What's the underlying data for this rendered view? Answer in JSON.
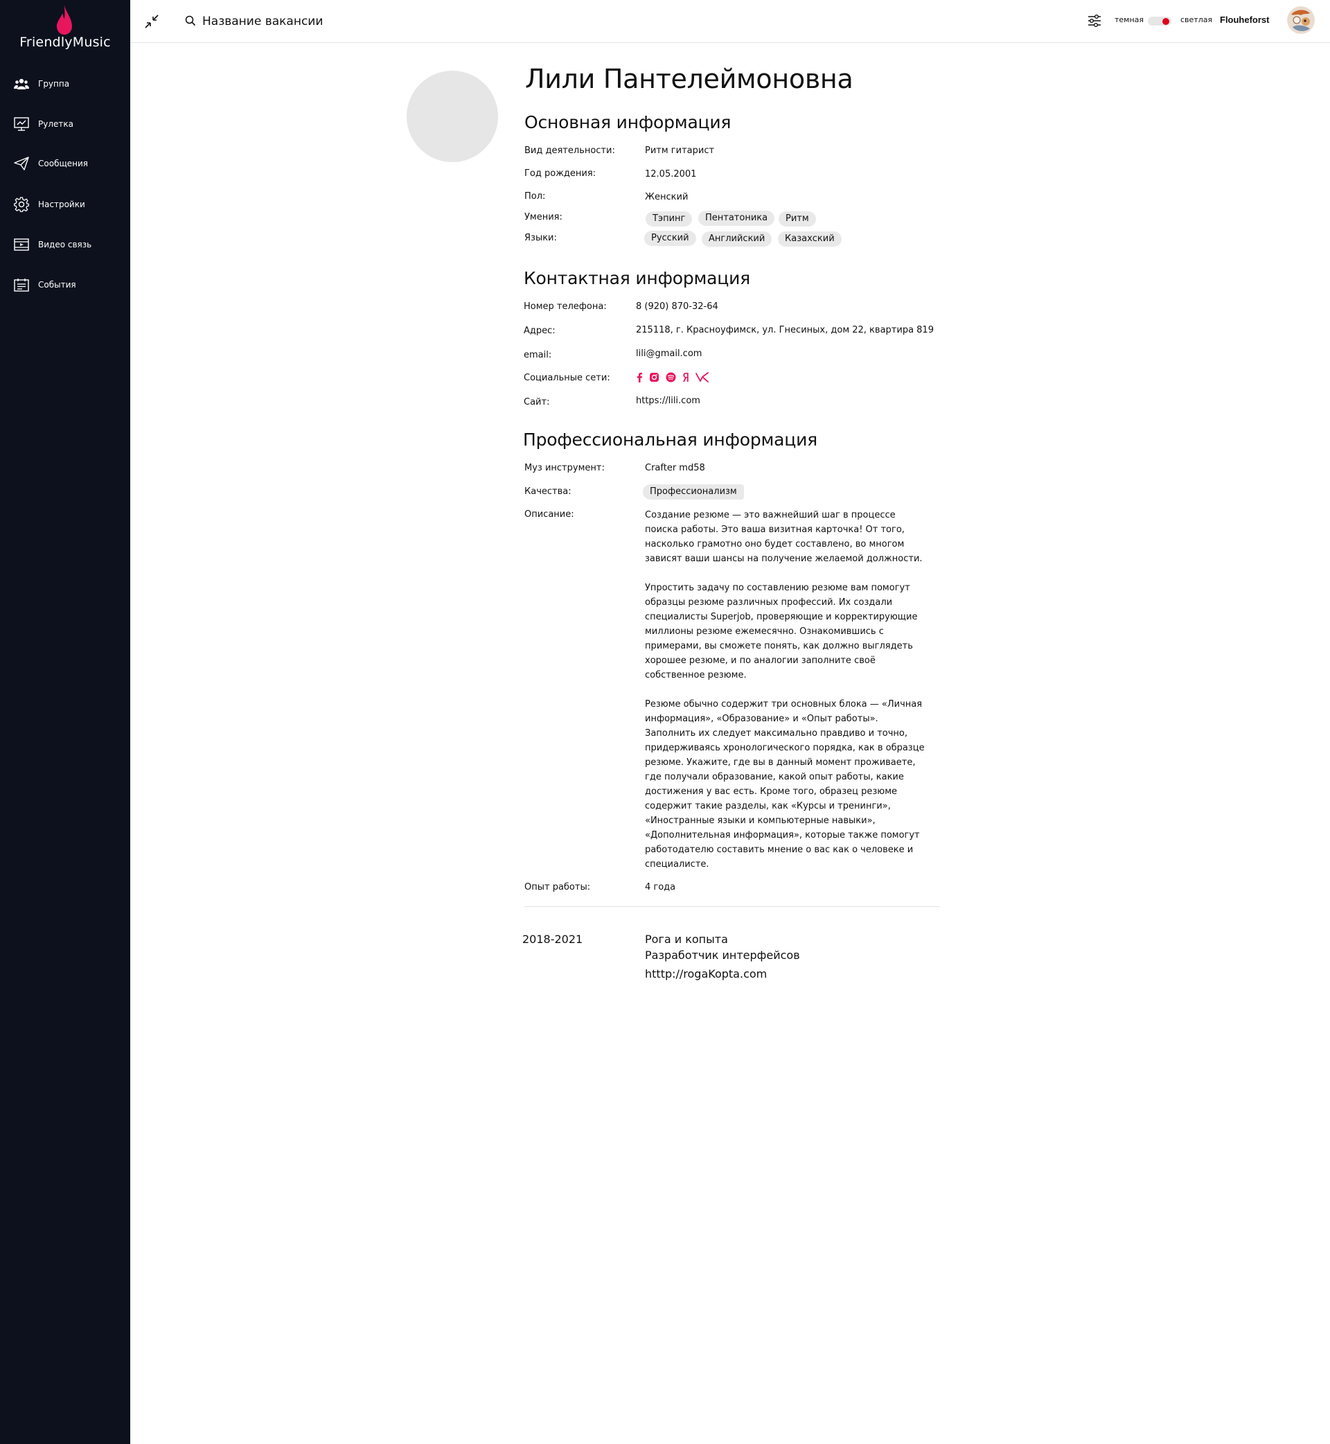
{
  "app": {
    "brand": "FriendlyMusic",
    "accent": "#e8175d"
  },
  "sidebar": {
    "items": [
      {
        "label": "Группа",
        "icon": "group-icon"
      },
      {
        "label": "Рулетка",
        "icon": "roulette-icon"
      },
      {
        "label": "Сообщения",
        "icon": "send-icon"
      },
      {
        "label": "Настройки",
        "icon": "gear-icon"
      },
      {
        "label": "Видео связь",
        "icon": "video-icon"
      },
      {
        "label": "События",
        "icon": "events-icon"
      }
    ]
  },
  "header": {
    "search_placeholder": "Название вакансии",
    "theme_dark": "темная",
    "theme_light": "светлая",
    "theme_toggle": "light",
    "username": "Flouheforst"
  },
  "profile": {
    "name": "Лили Пантелеймоновна",
    "basic": {
      "title": "Основная информация",
      "activity_label": "Вид деятельности:",
      "activity": "Ритм гитарист",
      "birth_label": "Год рождения:",
      "birth": "12.05.2001",
      "gender_label": "Пол:",
      "gender": "Женский",
      "skills_label": "Умения:",
      "skills": [
        "Тэпинг",
        "Пентатоника",
        "Ритм"
      ],
      "languages_label": "Языки:",
      "languages": [
        "Русский",
        "Английский",
        "Казахский"
      ]
    },
    "contact": {
      "title": "Контактная информация",
      "phone_label": "Номер телефона:",
      "phone": "8 (920) 870-32-64",
      "address_label": "Адрес:",
      "address": "215118, г. Красноуфимск, ул. Гнесиных, дом 22, квартира 819",
      "email_label": "email:",
      "email": "lili@gmail.com",
      "social_label": "Социальные сети:",
      "social_icons": [
        "facebook-icon",
        "instagram-icon",
        "spotify-icon",
        "yandex-icon",
        "vk-icon"
      ],
      "site_label": "Сайт:",
      "site": "https://lili.com"
    },
    "professional": {
      "title": "Профессиональная информация",
      "instrument_label": "Муз инструмент:",
      "instrument": "Crafter md58",
      "qualities_label": "Качества:",
      "qualities": [
        "Профессионализм"
      ],
      "description_label": "Описание:",
      "description": [
        "Создание резюме — это важнейший шаг в процессе поиска работы. Это ваша визитная карточка! От того, насколько грамотно оно будет составлено, во многом зависят ваши шансы на получение желаемой должности.",
        "Упростить задачу по составлению резюме вам помогут образцы резюме различных профессий. Их создали специалисты Superjob, проверяющие и корректирующие миллионы резюме ежемесячно. Ознакомившись с примерами, вы сможете понять, как должно выглядеть хорошее резюме, и по аналогии заполните своё собственное резюме.",
        "Резюме обычно содержит три основных блока — «Личная информация», «Образование» и «Опыт работы». Заполнить их следует максимально правдиво и точно, придерживаясь хронологического порядка, как в образце резюме. Укажите, где вы в данный момент проживаете, где получали образование, какой опыт работы, какие достижения у вас есть. Кроме того, образец резюме содержит такие разделы, как «Курсы и тренинги», «Иностранные языки и компьютерные навыки», «Дополнительная информация», которые также помогут работодателю составить мнение о вас как о человеке и специалисте."
      ],
      "experience_label": "Опыт работы:",
      "experience": "4 года",
      "jobs": [
        {
          "period": "2018-2021",
          "company": "Рога и копыта",
          "position": "Разработчик интерфейсов",
          "site": "htttp://rogaKopta.com"
        }
      ]
    }
  }
}
